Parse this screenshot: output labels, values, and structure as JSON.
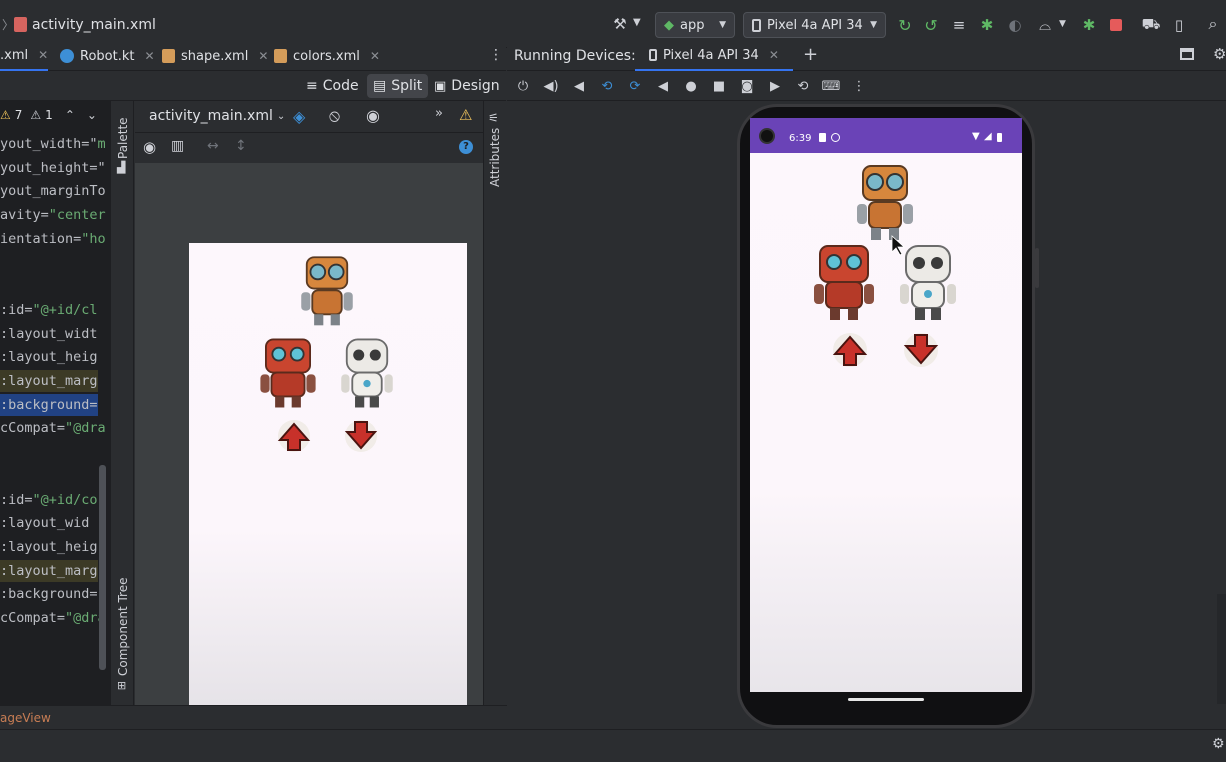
{
  "title_bar": {
    "file_name": "activity_main.xml",
    "run_config": "app",
    "device": "Pixel 4a API 34"
  },
  "editor_tabs": [
    {
      "label": ".xml",
      "active": true
    },
    {
      "label": "Robot.kt",
      "active": false
    },
    {
      "label": "shape.xml",
      "active": false
    },
    {
      "label": "colors.xml",
      "active": false
    }
  ],
  "running_devices": {
    "label": "Running Devices:",
    "tab": "Pixel 4a API 34",
    "add": "+"
  },
  "view_modes": {
    "code": "Code",
    "split": "Split",
    "design": "Design"
  },
  "inspections": {
    "warnings": "7",
    "weak_warnings": "1"
  },
  "code_lines": [
    {
      "text": "yout_width=\"",
      "str": "m",
      "hl": ""
    },
    {
      "text": "yout_height=\"",
      "str": "",
      "hl": ""
    },
    {
      "text": "yout_marginTo",
      "str": "",
      "hl": ""
    },
    {
      "text": "avity=",
      "str": "\"center",
      "hl": ""
    },
    {
      "text": "ientation=",
      "str": "\"ho",
      "hl": ""
    },
    {
      "text": "",
      "str": "",
      "hl": ""
    },
    {
      "text": "",
      "str": "",
      "hl": ""
    },
    {
      "text": ":id=",
      "str": "\"@+id/cl",
      "hl": ""
    },
    {
      "text": ":layout_widt",
      "str": "",
      "hl": ""
    },
    {
      "text": ":layout_heig",
      "str": "",
      "hl": ""
    },
    {
      "text": ":layout_marg",
      "str": "",
      "hl": "yellow"
    },
    {
      "text": ":background=",
      "str": "",
      "hl": "blue"
    },
    {
      "text": "cCompat=",
      "str": "\"@dra",
      "hl": ""
    },
    {
      "text": "",
      "str": "",
      "hl": ""
    },
    {
      "text": "",
      "str": "",
      "hl": ""
    },
    {
      "text": ":id=",
      "str": "\"@+id/co",
      "hl": ""
    },
    {
      "text": ":layout_wid",
      "str": "",
      "hl": ""
    },
    {
      "text": ":layout_heig",
      "str": "",
      "hl": ""
    },
    {
      "text": ":layout_marg",
      "str": "",
      "hl": "yellow"
    },
    {
      "text": ":background=",
      "str": "",
      "hl": ""
    },
    {
      "text": "cCompat=",
      "str": "\"@dra",
      "hl": ""
    }
  ],
  "design_toolbar": {
    "file_select": "activity_main.xml"
  },
  "side_panels": {
    "palette": "Palette",
    "component_tree": "Component Tree",
    "attributes": "Attributes"
  },
  "phone_status": {
    "time": "6:39"
  },
  "footer": {
    "breadcrumb": "ageView"
  },
  "colors": {
    "accent": "#3574f0",
    "status_bar": "#6a43b7",
    "run_green": "#5fb865",
    "stop_red": "#e55b5b",
    "warning": "#f2c55c"
  }
}
